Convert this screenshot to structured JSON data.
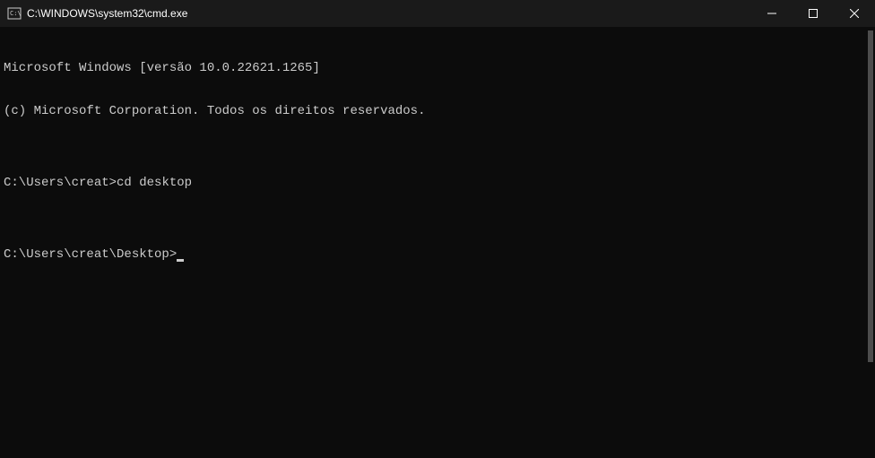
{
  "titlebar": {
    "title": "C:\\WINDOWS\\system32\\cmd.exe"
  },
  "terminal": {
    "line1": "Microsoft Windows [versão 10.0.22621.1265]",
    "line2": "(c) Microsoft Corporation. Todos os direitos reservados.",
    "blank1": "",
    "prompt1": "C:\\Users\\creat>",
    "command1": "cd desktop",
    "blank2": "",
    "prompt2": "C:\\Users\\creat\\Desktop>"
  }
}
